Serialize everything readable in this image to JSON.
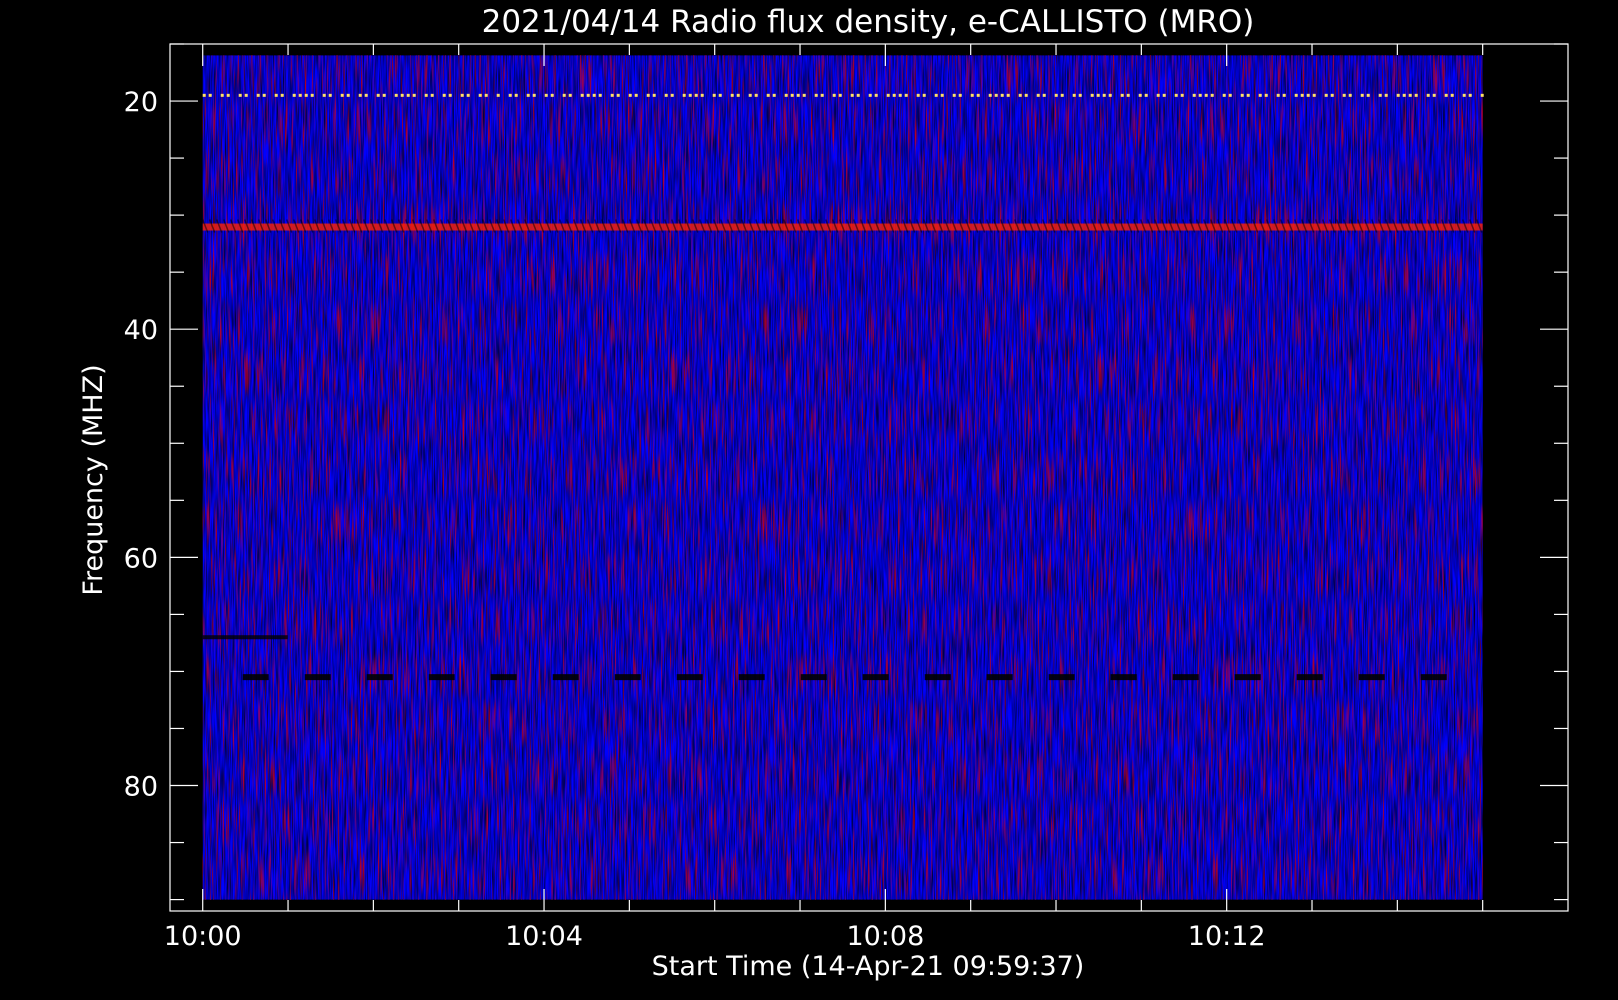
{
  "chart_data": {
    "type": "heatmap",
    "title": "2021/04/14  Radio flux density, e-CALLISTO (MRO)",
    "xlabel": "Start Time (14-Apr-21 09:59:37)",
    "ylabel": "Frequency (MHZ)",
    "x_range": [
      "09:59:37",
      "10:16:00"
    ],
    "data_x_range": [
      "10:00:00",
      "10:15:00"
    ],
    "ylim": [
      91,
      15
    ],
    "data_y_range": [
      16,
      90
    ],
    "x_ticks": [
      "10:00",
      "10:04",
      "10:08",
      "10:12"
    ],
    "y_ticks": [
      20,
      40,
      60,
      80
    ],
    "background_level": "blue",
    "features": [
      {
        "kind": "bright-line",
        "frequency_mhz": 19.5,
        "color": "#ffe066"
      },
      {
        "kind": "emission-band",
        "frequency_mhz": 31,
        "color": "#ff2200"
      },
      {
        "kind": "dark-band",
        "frequency_mhz": 70.5,
        "color": "#000000"
      },
      {
        "kind": "dark-band",
        "frequency_mhz": 67,
        "color": "#000000"
      }
    ],
    "colors": {
      "background": "#0000ff",
      "high": "#ff0000",
      "low": "#000000",
      "frame": "#ffffff"
    }
  }
}
